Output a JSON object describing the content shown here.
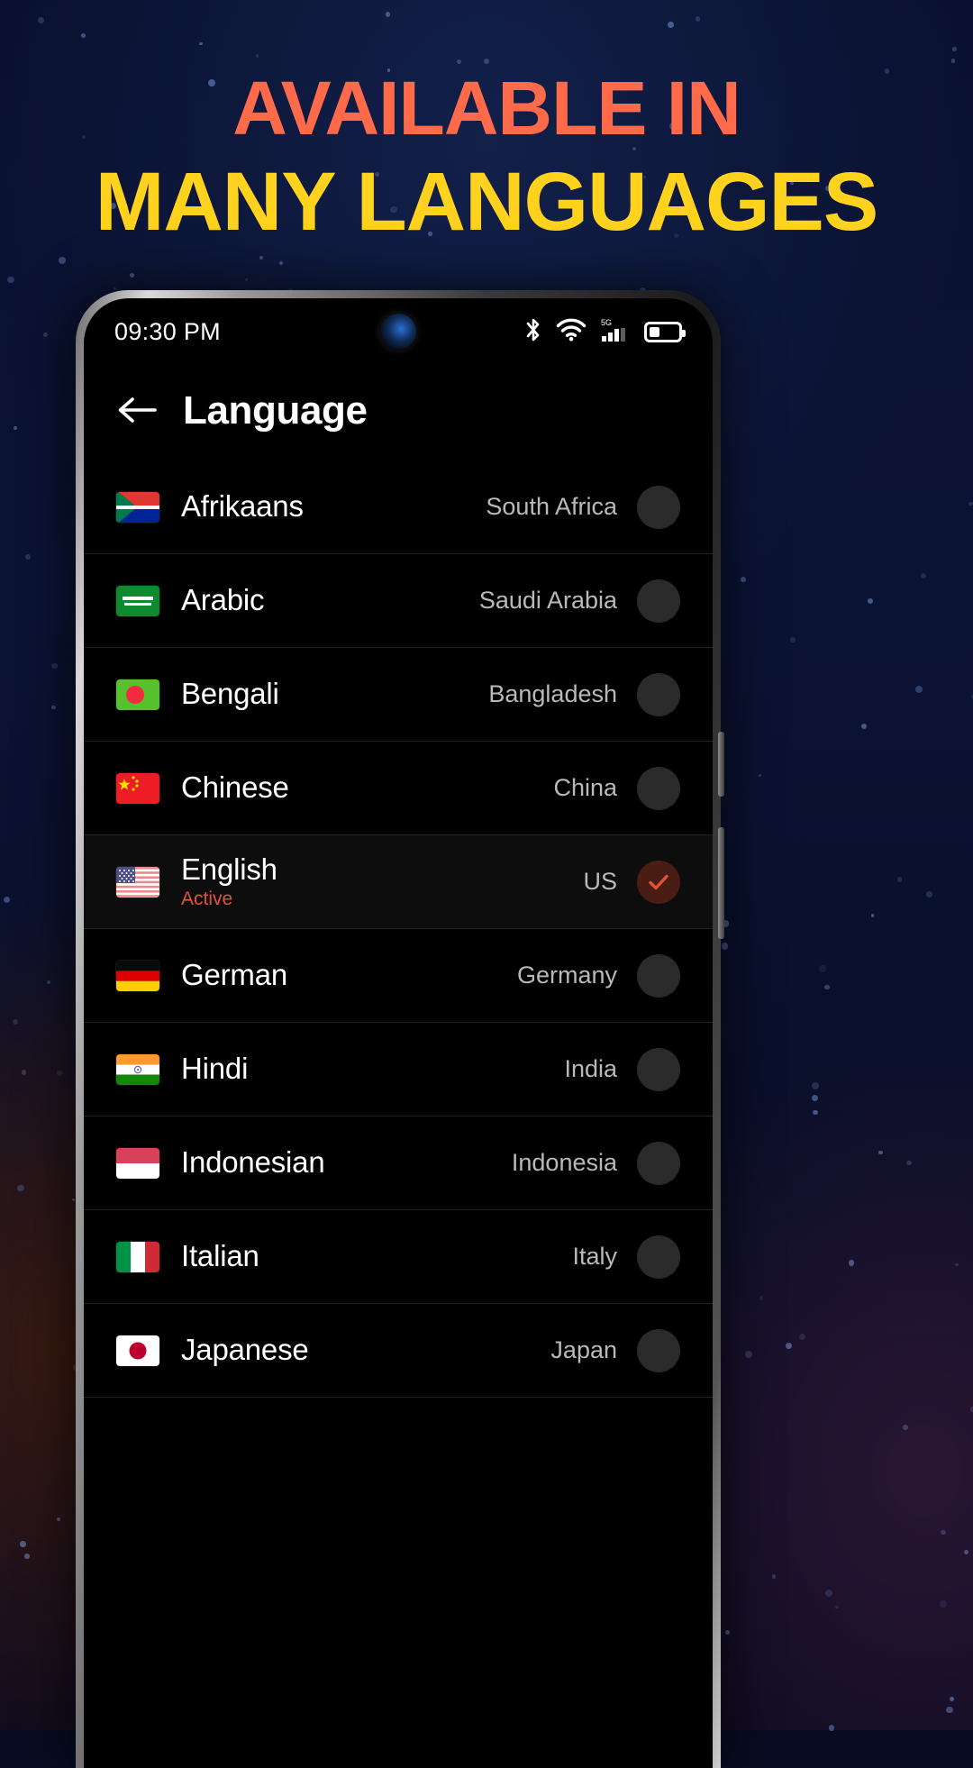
{
  "headline": {
    "line1": "AVAILABLE IN",
    "line2": "MANY LANGUAGES",
    "color1": "#ff6b4a",
    "color2": "#ffd21e"
  },
  "statusbar": {
    "time": "09:30 PM",
    "icons": [
      "bluetooth-icon",
      "wifi-icon",
      "signal-5g-icon",
      "battery-icon"
    ],
    "network_label": "5G"
  },
  "appbar": {
    "back_label": "Back",
    "title": "Language"
  },
  "list": {
    "rows": [
      {
        "language": "Afrikaans",
        "country": "South Africa",
        "sub": "",
        "selected": false,
        "flag": "za"
      },
      {
        "language": "Arabic",
        "country": "Saudi Arabia",
        "sub": "",
        "selected": false,
        "flag": "sa"
      },
      {
        "language": "Bengali",
        "country": "Bangladesh",
        "sub": "",
        "selected": false,
        "flag": "bd"
      },
      {
        "language": "Chinese",
        "country": "China",
        "sub": "",
        "selected": false,
        "flag": "cn"
      },
      {
        "language": "English",
        "country": "US",
        "sub": "Active",
        "selected": true,
        "flag": "us"
      },
      {
        "language": "German",
        "country": "Germany",
        "sub": "",
        "selected": false,
        "flag": "de"
      },
      {
        "language": "Hindi",
        "country": "India",
        "sub": "",
        "selected": false,
        "flag": "in"
      },
      {
        "language": "Indonesian",
        "country": "Indonesia",
        "sub": "",
        "selected": false,
        "flag": "id"
      },
      {
        "language": "Italian",
        "country": "Italy",
        "sub": "",
        "selected": false,
        "flag": "it"
      },
      {
        "language": "Japanese",
        "country": "Japan",
        "sub": "",
        "selected": false,
        "flag": "jp"
      }
    ]
  },
  "theme": {
    "accent": "#e2513a",
    "screen_bg": "#000000",
    "text_primary": "#ffffff",
    "text_secondary": "#b9b9b9"
  }
}
